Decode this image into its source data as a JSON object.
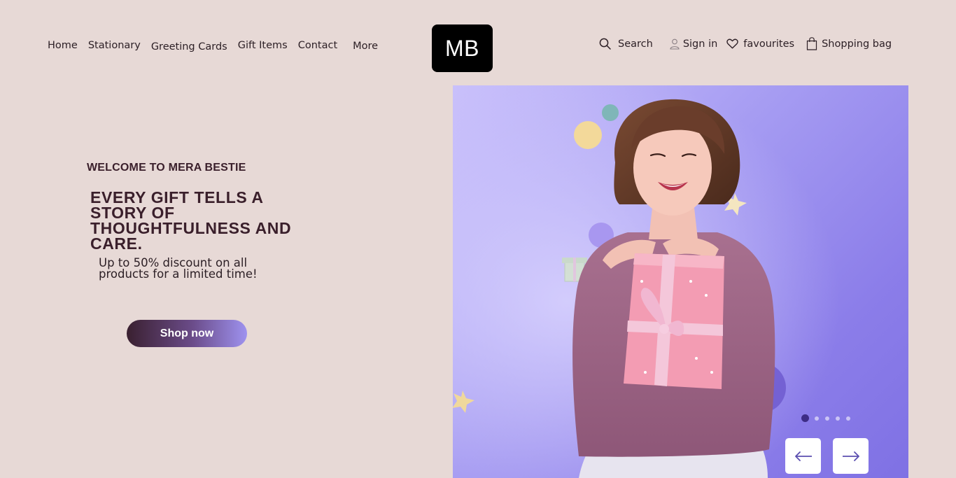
{
  "nav": {
    "links": [
      "Home",
      "Stationary",
      "Greeting Cards",
      "Gift Items",
      "Contact",
      "More"
    ],
    "logo": "MB",
    "search_label": "Search",
    "signin_label": "Sign in",
    "favourites_label": "favourites",
    "bag_label": "Shopping bag"
  },
  "hero": {
    "eyebrow": "WELCOME TO MERA BESTIE",
    "headline": "EVERY GIFT TELLS A STORY OF THOUGHTFULNESS AND CARE.",
    "subtext": "Up to 50% discount on all products for a limited time!",
    "cta_label": "Shop now",
    "slide_count": 5,
    "active_slide": 1
  },
  "colors": {
    "page_bg": "#e7d9d6",
    "text_dark": "#3a1f2b",
    "hero_purple": "#8b7de9",
    "active_dot": "#3d2c86"
  },
  "icons": {
    "search": "search-icon",
    "user": "user-icon",
    "favourites": "heart-icon",
    "bag": "shopping-bag-icon",
    "prev": "arrow-left-icon",
    "next": "arrow-right-icon"
  }
}
